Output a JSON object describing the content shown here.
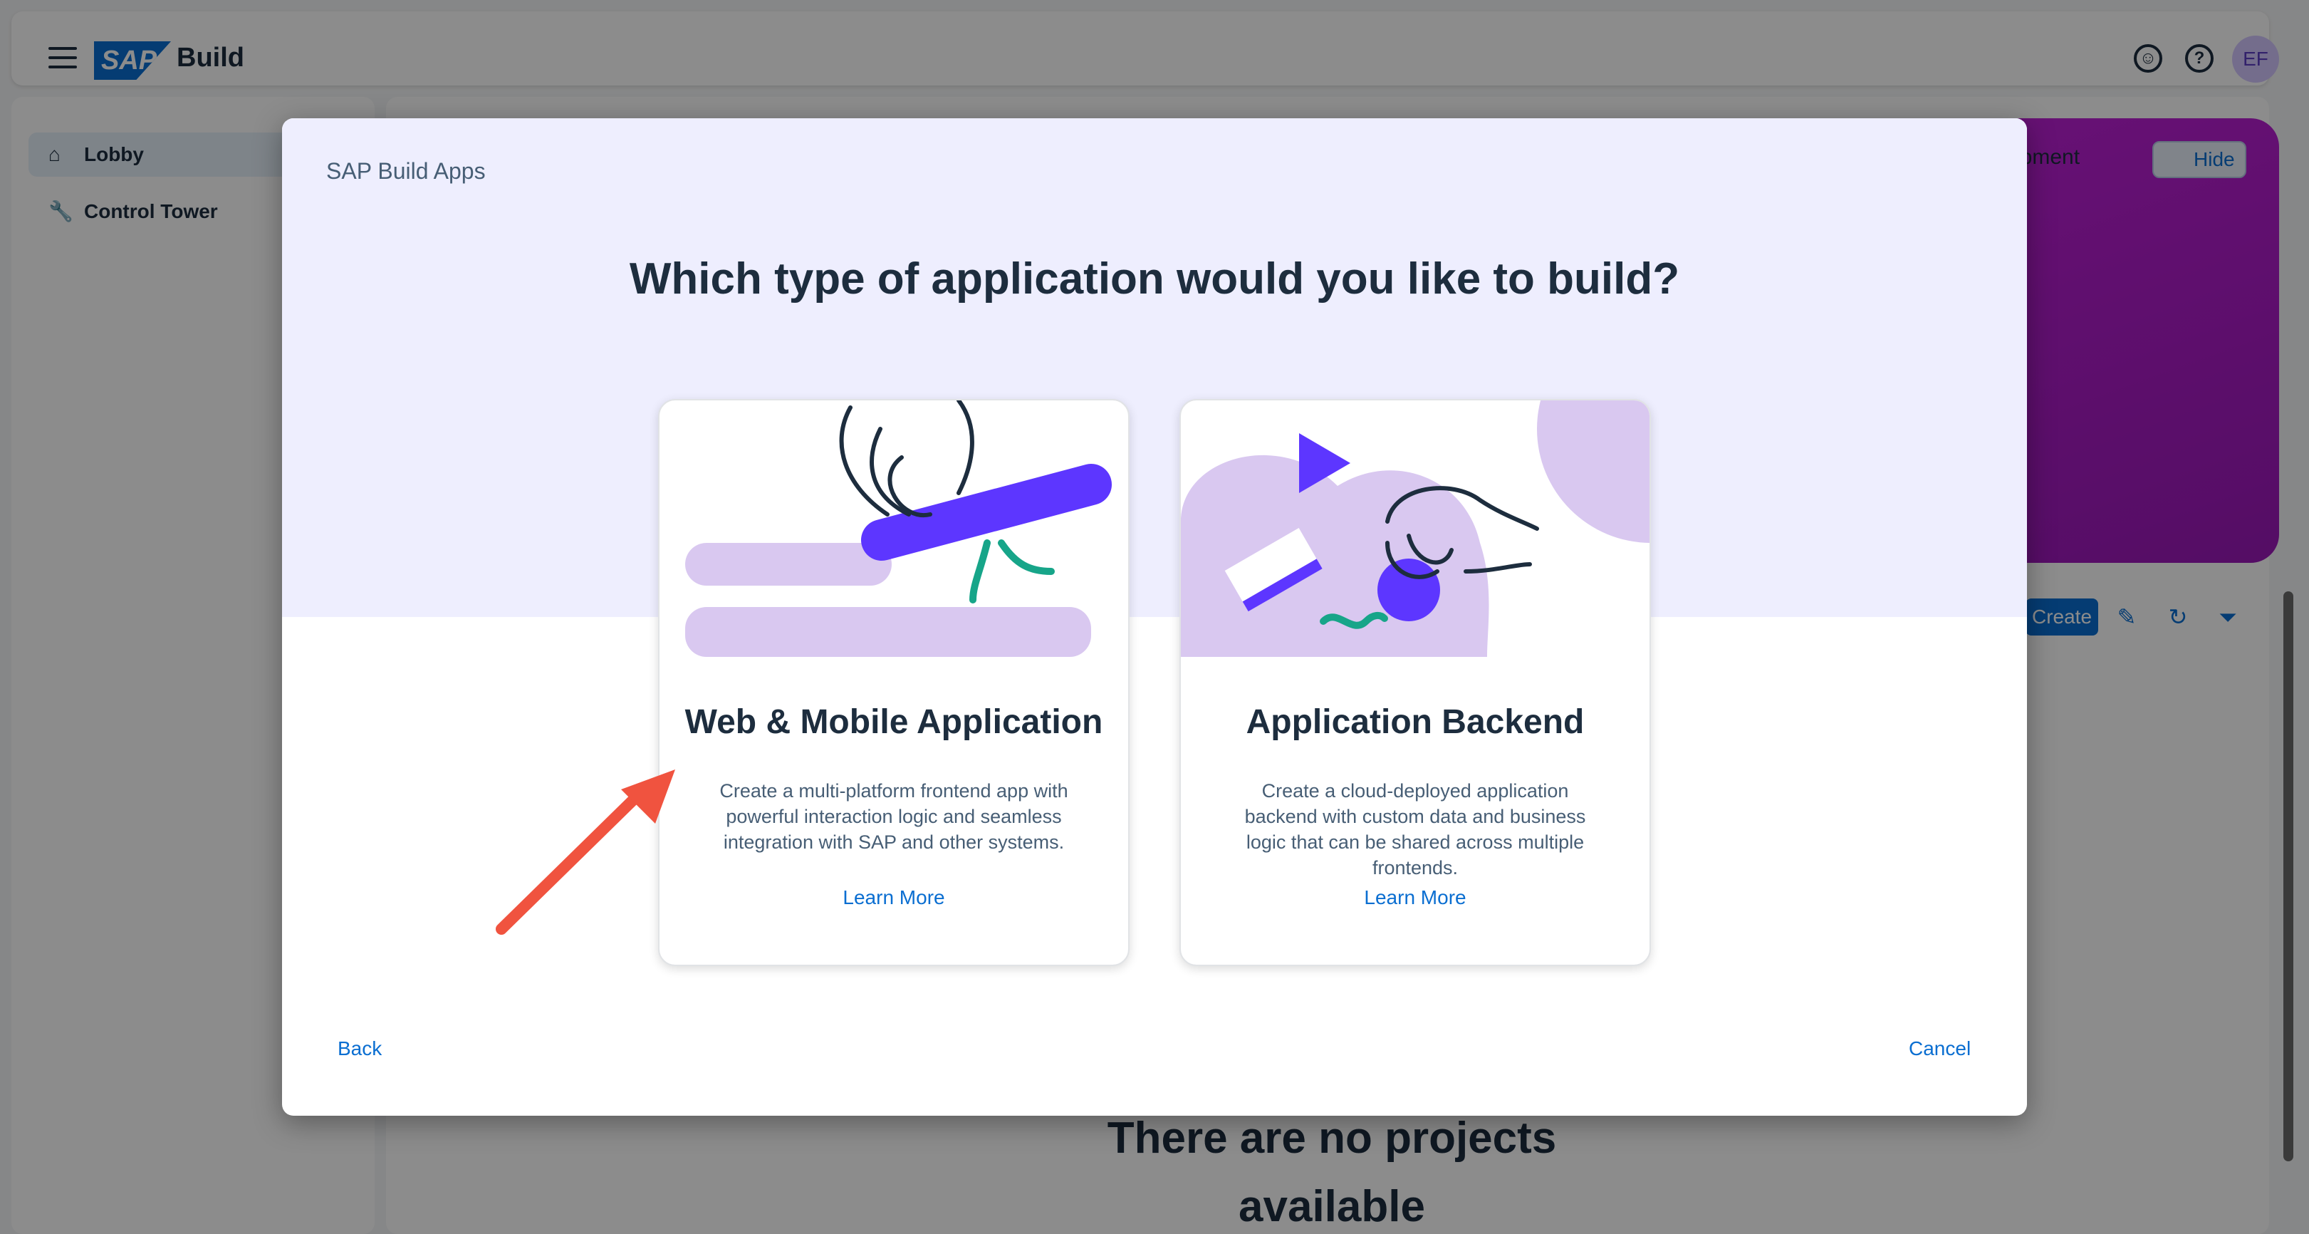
{
  "shell": {
    "title": "Build",
    "logo_text": "SAP",
    "avatar_initials": "EF",
    "icons": [
      "feedback-icon",
      "help-icon"
    ]
  },
  "sidenav": {
    "items": [
      {
        "label": "Lobby",
        "icon": "home-icon",
        "active": true
      },
      {
        "label": "Control Tower",
        "icon": "wrench-icon",
        "active": false
      }
    ]
  },
  "background": {
    "banner_text": "opment",
    "hide_label": "Hide",
    "create_label": "Create",
    "empty_message_line1": "There are no projects",
    "empty_message_line2": "available"
  },
  "dialog": {
    "header": "SAP Build Apps",
    "question": "Which type of application would you like to build?",
    "cards": [
      {
        "title": "Web & Mobile Application",
        "description": "Create a multi-platform frontend app with powerful interaction logic and seamless integration with SAP and other systems.",
        "link": "Learn More"
      },
      {
        "title": "Application Backend",
        "description": "Create a cloud-deployed application backend with custom data and business logic that can be shared across multiple frontends.",
        "link": "Learn More"
      }
    ],
    "back_label": "Back",
    "cancel_label": "Cancel"
  },
  "colors": {
    "accent": "#0a6ed1",
    "purple": "#5d36ff",
    "lilac": "#d9c8f0",
    "teal": "#17a589",
    "annotation_arrow": "#f0533f"
  }
}
